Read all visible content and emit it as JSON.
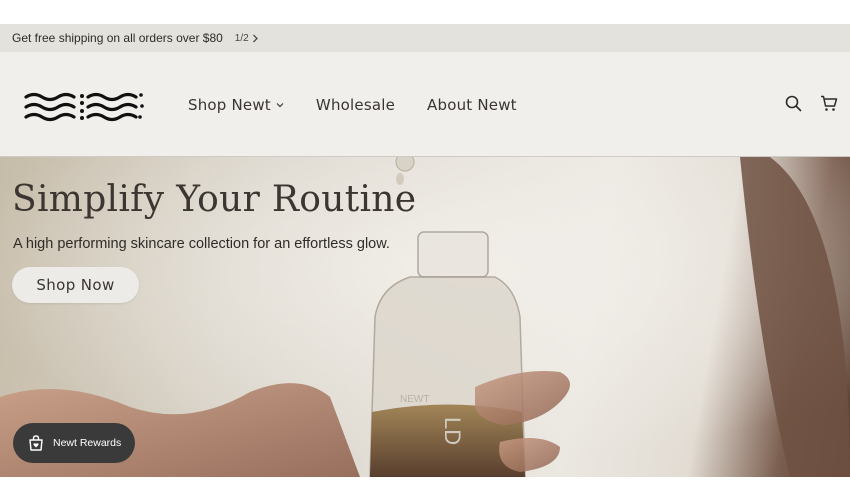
{
  "announcement": {
    "text": "Get free shipping on all orders over $80",
    "pager": "1/2",
    "pager_icon": "chevron-right-icon"
  },
  "header": {
    "logo_icon": "newt-wave-logo",
    "nav": [
      {
        "label": "Shop Newt",
        "has_dropdown": true
      },
      {
        "label": "Wholesale"
      },
      {
        "label": "About Newt"
      }
    ],
    "icons": [
      "search-icon",
      "cart-icon"
    ]
  },
  "hero": {
    "title": "Simplify Your Routine",
    "subtitle": "A high performing skincare collection for an effortless glow.",
    "cta": "Shop Now",
    "image_icon": "dropper-bottle-photo"
  },
  "rewards": {
    "label": "Newt Rewards",
    "icon": "bag-heart-icon"
  },
  "colors": {
    "announcement_bg": "#e4e2dd",
    "header_bg": "#f1efeb",
    "text": "#2f2b28",
    "rewards_bg": "#3a3a3a"
  }
}
